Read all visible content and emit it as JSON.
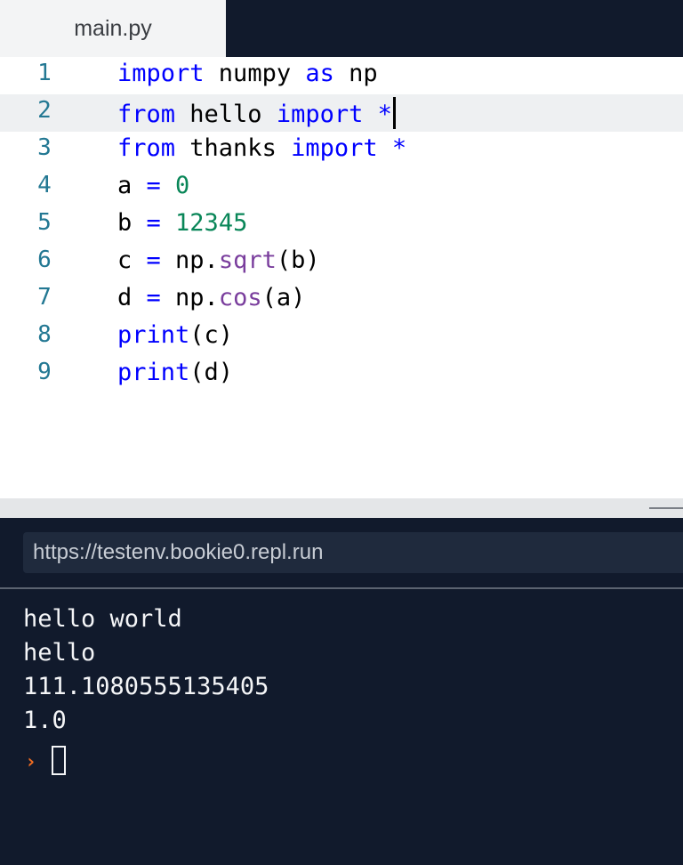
{
  "tab": {
    "filename": "main.py"
  },
  "editor": {
    "lines": [
      {
        "num": "1",
        "tokens": [
          {
            "t": "kw",
            "v": "import"
          },
          {
            "t": "txt",
            "v": " numpy "
          },
          {
            "t": "kw",
            "v": "as"
          },
          {
            "t": "txt",
            "v": " np"
          }
        ]
      },
      {
        "num": "2",
        "tokens": [
          {
            "t": "kw",
            "v": "from"
          },
          {
            "t": "txt",
            "v": " hello "
          },
          {
            "t": "kw",
            "v": "import"
          },
          {
            "t": "txt",
            "v": " "
          },
          {
            "t": "kw",
            "v": "*"
          }
        ]
      },
      {
        "num": "3",
        "tokens": [
          {
            "t": "kw",
            "v": "from"
          },
          {
            "t": "txt",
            "v": " thanks "
          },
          {
            "t": "kw",
            "v": "import"
          },
          {
            "t": "txt",
            "v": " "
          },
          {
            "t": "kw",
            "v": "*"
          }
        ]
      },
      {
        "num": "4",
        "tokens": [
          {
            "t": "txt",
            "v": "a "
          },
          {
            "t": "kw",
            "v": "="
          },
          {
            "t": "txt",
            "v": " "
          },
          {
            "t": "num",
            "v": "0"
          }
        ]
      },
      {
        "num": "5",
        "tokens": [
          {
            "t": "txt",
            "v": "b "
          },
          {
            "t": "kw",
            "v": "="
          },
          {
            "t": "txt",
            "v": " "
          },
          {
            "t": "num",
            "v": "12345"
          }
        ]
      },
      {
        "num": "6",
        "tokens": [
          {
            "t": "txt",
            "v": "c "
          },
          {
            "t": "kw",
            "v": "="
          },
          {
            "t": "txt",
            "v": " np."
          },
          {
            "t": "fn",
            "v": "sqrt"
          },
          {
            "t": "txt",
            "v": "(b)"
          }
        ]
      },
      {
        "num": "7",
        "tokens": [
          {
            "t": "txt",
            "v": "d "
          },
          {
            "t": "kw",
            "v": "="
          },
          {
            "t": "txt",
            "v": " np."
          },
          {
            "t": "fn",
            "v": "cos"
          },
          {
            "t": "txt",
            "v": "(a)"
          }
        ]
      },
      {
        "num": "8",
        "tokens": [
          {
            "t": "kw",
            "v": "print"
          },
          {
            "t": "txt",
            "v": "(c)"
          }
        ]
      },
      {
        "num": "9",
        "tokens": [
          {
            "t": "kw",
            "v": "print"
          },
          {
            "t": "txt",
            "v": "(d)"
          }
        ]
      }
    ],
    "active_line": "2",
    "colors": {
      "keyword": "#0000ff",
      "number": "#098658",
      "function": "#7a3e9d",
      "line_number": "#237893"
    }
  },
  "webview": {
    "url": "https://testenv.bookie0.repl.run"
  },
  "console": {
    "output": [
      "hello world",
      "hello",
      "111.1080555135405",
      "1.0"
    ],
    "prompt_symbol": "›",
    "prompt_color": "#f26d21"
  }
}
